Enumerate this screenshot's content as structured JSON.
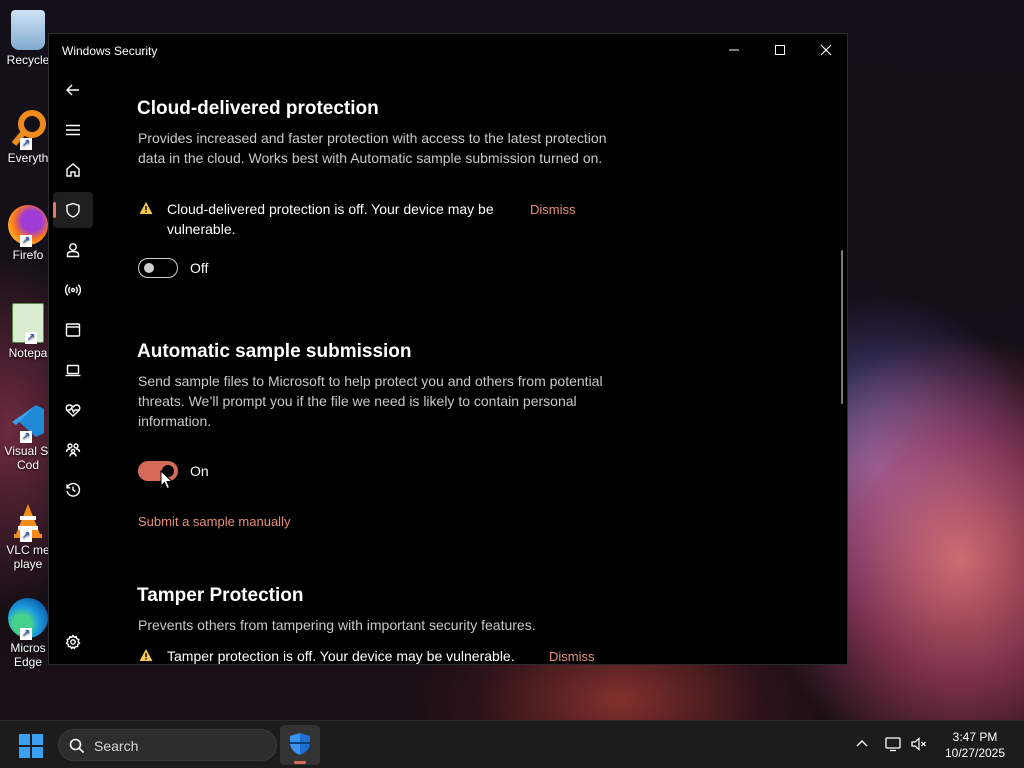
{
  "window": {
    "title": "Windows Security",
    "minimize_icon": "minimize-icon",
    "maximize_icon": "maximize-icon",
    "close_icon": "close-icon"
  },
  "desktop": {
    "icons": [
      {
        "label": "Recycle",
        "icon": "recycle-bin-icon"
      },
      {
        "label": "Everyth",
        "icon": "everything-search-icon"
      },
      {
        "label": "Firefo",
        "icon": "firefox-icon"
      },
      {
        "label": "Notepa",
        "icon": "notepad-icon"
      },
      {
        "label": "Visual St\nCod",
        "icon": "vscode-icon"
      },
      {
        "label": "VLC me\nplaye",
        "icon": "vlc-icon"
      },
      {
        "label": "Micros\nEdge",
        "icon": "edge-icon"
      }
    ]
  },
  "nav": {
    "items": [
      {
        "icon": "back-arrow-icon"
      },
      {
        "icon": "menu-icon"
      },
      {
        "icon": "home-icon"
      },
      {
        "icon": "shield-icon",
        "active": true
      },
      {
        "icon": "account-icon"
      },
      {
        "icon": "network-icon"
      },
      {
        "icon": "app-browser-icon"
      },
      {
        "icon": "device-security-icon"
      },
      {
        "icon": "health-icon"
      },
      {
        "icon": "family-icon"
      },
      {
        "icon": "history-icon"
      },
      {
        "icon": "settings-icon"
      }
    ]
  },
  "sections": {
    "cloud": {
      "title": "Cloud-delivered protection",
      "desc": "Provides increased and faster protection with access to the latest protection data in the cloud. Works best with Automatic sample submission turned on.",
      "warning_line1": "Cloud-delivered protection is off. Your device may be",
      "warning_line2": "vulnerable.",
      "dismiss": "Dismiss",
      "toggle_state": "Off"
    },
    "sample": {
      "title": "Automatic sample submission",
      "desc": "Send sample files to Microsoft to help protect you and others from potential threats. We’ll prompt you if the file we need is likely to contain personal information.",
      "toggle_state": "On",
      "link": "Submit a sample manually"
    },
    "tamper": {
      "title": "Tamper Protection",
      "desc": "Prevents others from tampering with important security features.",
      "warning": "Tamper protection is off. Your device may be vulnerable.",
      "dismiss": "Dismiss"
    }
  },
  "taskbar": {
    "search_placeholder": "Search",
    "time": "3:47 PM",
    "date": "10/27/2025"
  },
  "colors": {
    "accent": "#d66a58",
    "link": "#e8907e",
    "warning": "#f2c94c"
  }
}
